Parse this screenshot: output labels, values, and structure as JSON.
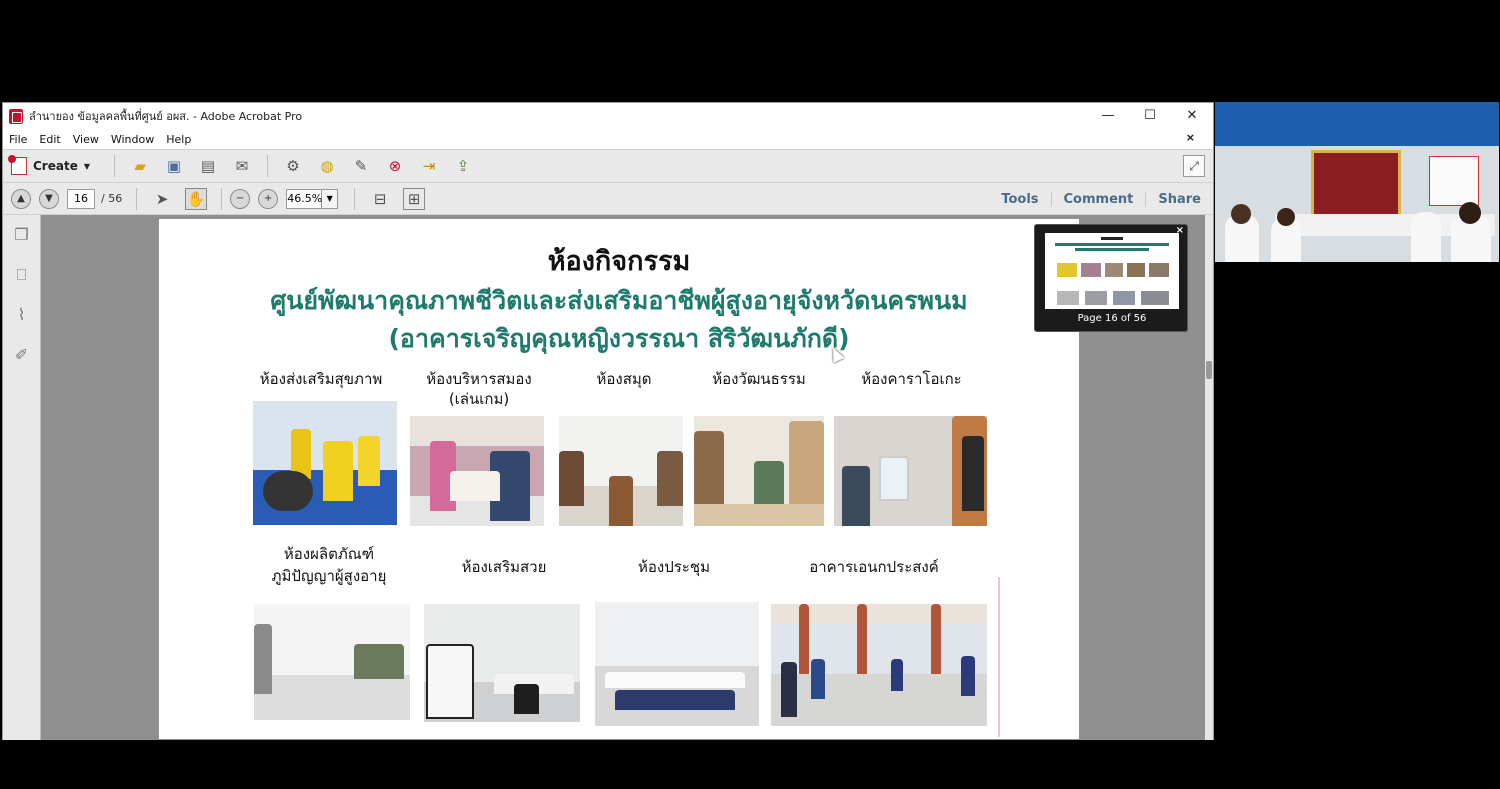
{
  "window": {
    "title": "ลำนายอง ข้อมูลคลพื้นที่ศูนย์ อผส. - Adobe Acrobat Pro",
    "minimize": "—",
    "maximize": "☐",
    "close": "✕"
  },
  "menu": [
    "File",
    "Edit",
    "View",
    "Window",
    "Help"
  ],
  "menu_close": "×",
  "toolbar": {
    "create_label": "Create",
    "icons": [
      "open-folder-icon",
      "save-icon",
      "print-icon",
      "email-icon",
      "gear-icon",
      "comment-icon",
      "sign-icon",
      "delete-page-icon",
      "export-icon",
      "upload-icon"
    ]
  },
  "nav": {
    "current_page": "16",
    "total_pages": "/ 56",
    "zoom": "46.5%"
  },
  "right_tabs": {
    "tools": "Tools",
    "comment": "Comment",
    "share": "Share"
  },
  "slide": {
    "title": "ห้องกิจกรรม",
    "subtitle1": "ศูนย์พัฒนาคุณภาพชีวิตและส่งเสริมอาชีพผู้สูงอายุจังหวัดนครพนม",
    "subtitle2": "(อาคารเจริญคุณหญิงวรรณา สิริวัฒนภักดี)",
    "rooms_row1": [
      "ห้องส่งเสริมสุขภาพ",
      "ห้องบริหารสมอง",
      "(เล่นเกม)",
      "ห้องสมุด",
      "ห้องวัฒนธรรม",
      "ห้องคาราโอเกะ"
    ],
    "rooms_row2": [
      "ห้องผลิตภัณฑ์",
      "ภูมิปัญญาผู้สูงอายุ",
      "ห้องเสริมสวย",
      "ห้องประชุม",
      "อาคารเอนกประสงค์"
    ]
  },
  "thumbnail": {
    "caption": "Page 16 of 56",
    "close": "×"
  },
  "colors": {
    "title_teal": "#1f7a6e",
    "tab_blue": "#4a6b8a",
    "acrobat_red": "#c8102e"
  }
}
